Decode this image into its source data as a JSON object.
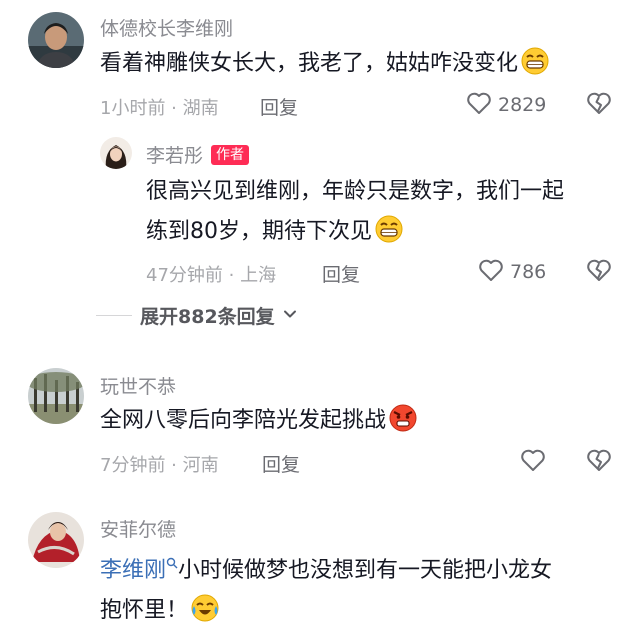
{
  "comments": [
    {
      "username": "体德校长李维刚",
      "text": "看着神雕侠女长大，我老了，姑姑咋没变化",
      "meta": "1小时前 · 湖南",
      "reply_label": "回复",
      "like_count": "2829"
    },
    {
      "username": "玩世不恭",
      "text": "全网八零后向李陪光发起挑战",
      "meta": "7分钟前 · 河南",
      "reply_label": "回复"
    },
    {
      "username": "安菲尔德",
      "mention": "李维刚",
      "text_line1": "小时候做梦也没想到有一天能把小龙女",
      "text_line2": "抱怀里！"
    }
  ],
  "reply": {
    "username": "李若彤",
    "author_tag": "作者",
    "text_line1": "很高兴见到维刚，年龄只是数字，我们一起",
    "text_line2": "练到80岁，期待下次见",
    "meta": "47分钟前 · 上海",
    "reply_label": "回复",
    "like_count": "786"
  },
  "expand": {
    "label": "展开882条回复"
  },
  "icons": [
    "grin-emoji-icon",
    "angry-emoji-icon",
    "laugh-cry-emoji-icon",
    "heart-icon",
    "broken-heart-icon",
    "chevron-down-icon",
    "search-icon"
  ],
  "colors": {
    "author_tag": "#fe2c55",
    "mention": "#3b6fb6",
    "muted": "#a6a7ab"
  }
}
